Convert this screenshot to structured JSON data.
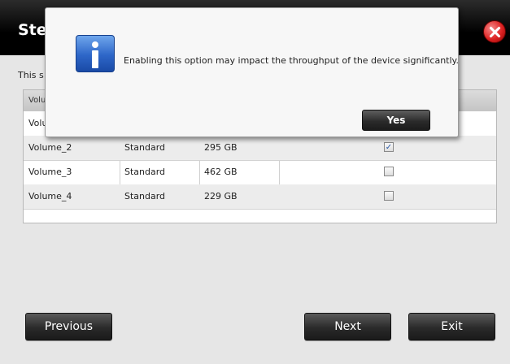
{
  "window": {
    "title": "Ste",
    "description": "This s"
  },
  "table": {
    "header_partial": "Volu",
    "rows": [
      {
        "name": "Volu",
        "type": "",
        "size": "",
        "checked": false
      },
      {
        "name": "Volume_2",
        "type": "Standard",
        "size": "295 GB",
        "checked": true
      },
      {
        "name": "Volume_3",
        "type": "Standard",
        "size": "462 GB",
        "checked": false
      },
      {
        "name": "Volume_4",
        "type": "Standard",
        "size": "229 GB",
        "checked": false
      }
    ]
  },
  "buttons": {
    "previous": "Previous",
    "next": "Next",
    "exit": "Exit"
  },
  "dialog": {
    "message": "Enabling this option may impact the throughput of the device significantly.",
    "yes": "Yes",
    "icon": "info-icon"
  },
  "colors": {
    "title_bar": "#000000",
    "info_blue": "#2d66c8",
    "close_red": "#d22222"
  }
}
